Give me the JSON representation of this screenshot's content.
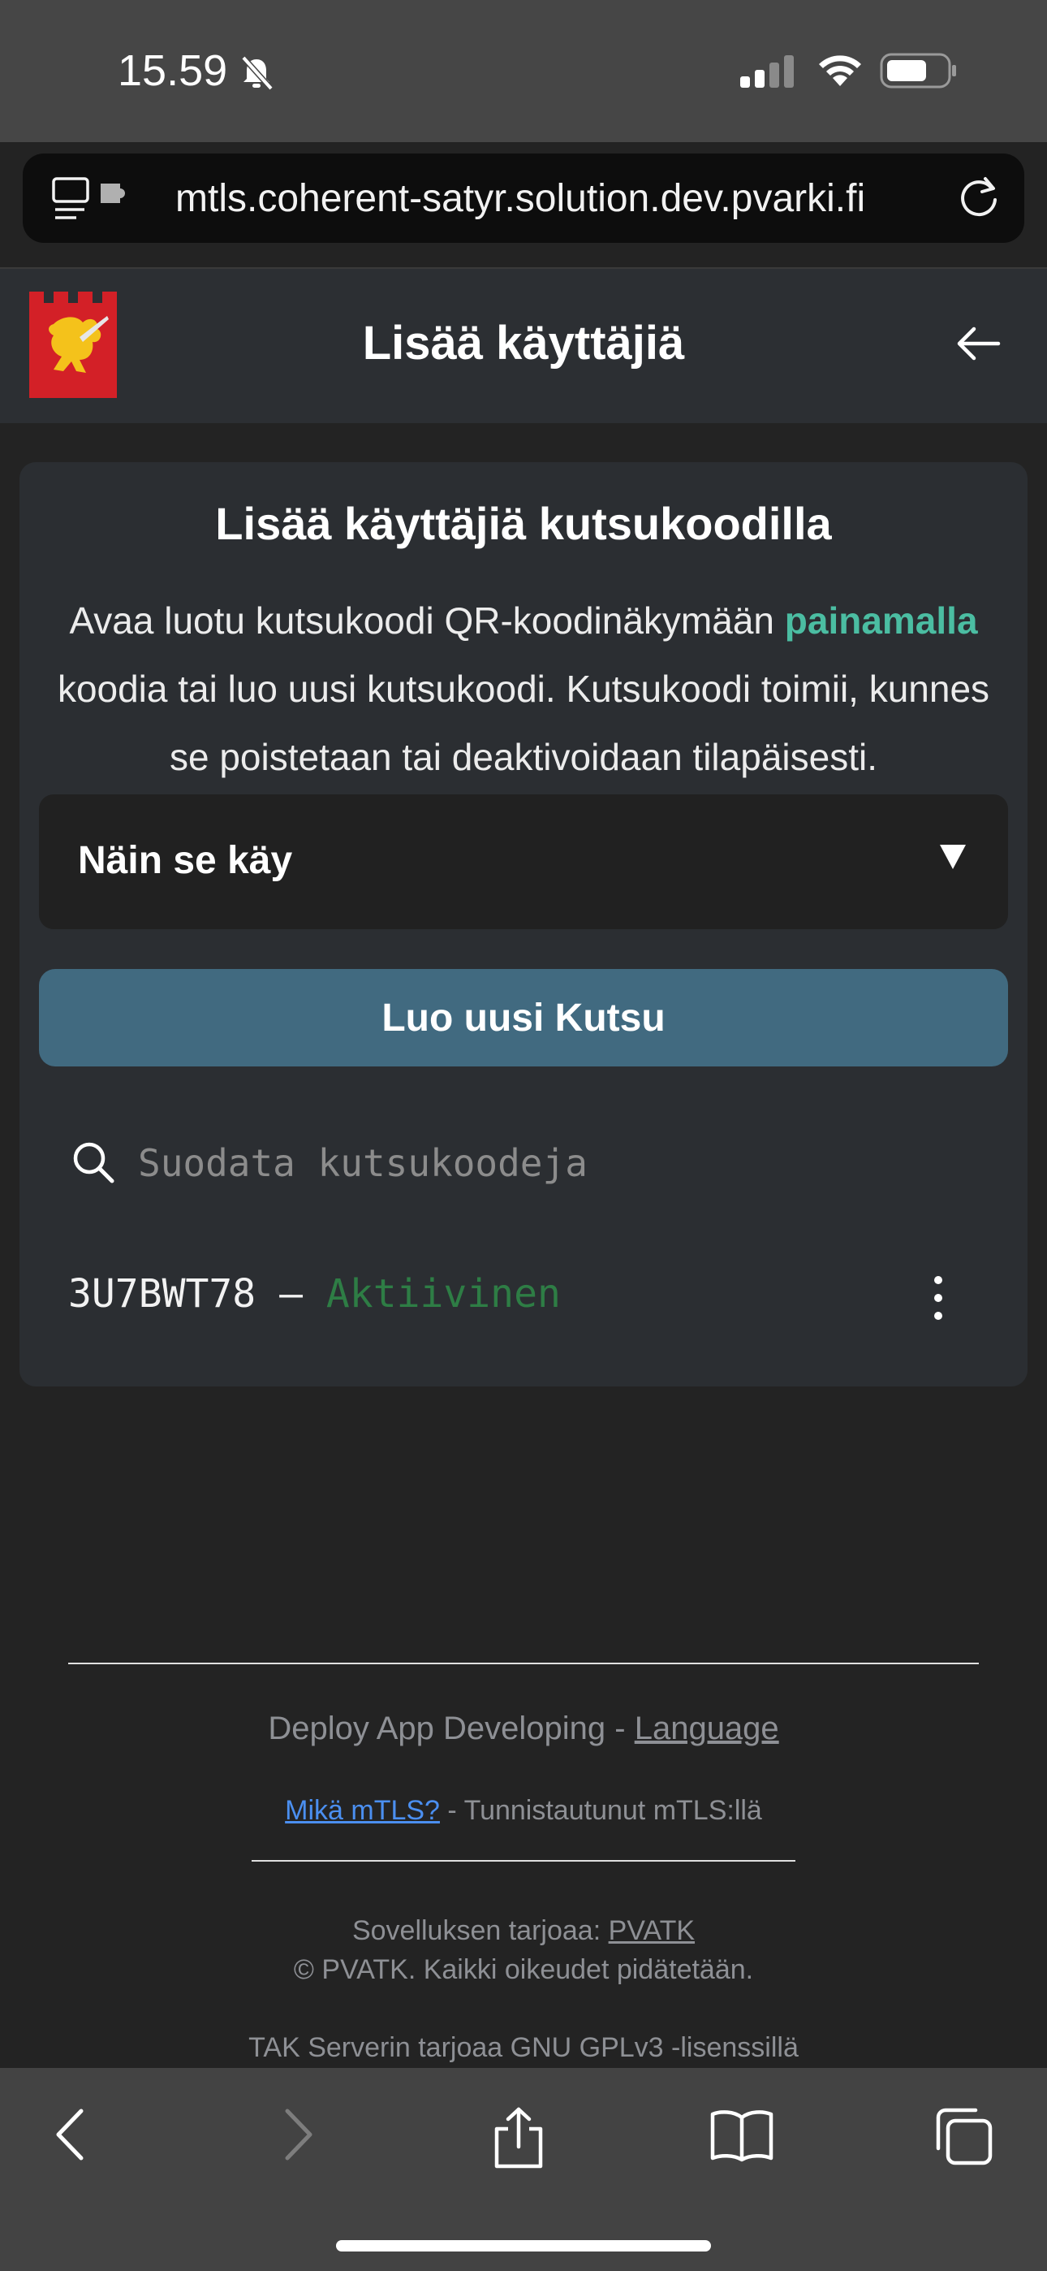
{
  "status_bar": {
    "time": "15.59"
  },
  "browser": {
    "url": "mtls.coherent-satyr.solution.dev.pvarki.fi"
  },
  "header": {
    "title": "Lisää käyttäjiä"
  },
  "card": {
    "title": "Lisää käyttäjiä kutsukoodilla",
    "desc_pre": "Avaa luotu kutsukoodi QR-koodinäkymään ",
    "desc_accent": "painamalla",
    "desc_post": " koodia tai luo uusi kutsukoodi. Kutsukoodi toimii, kunnes se poistetaan tai deaktivoidaan tilapäisesti.",
    "howto_label": "Näin se käy",
    "create_button": "Luo uusi Kutsu",
    "search_placeholder": "Suodata kutsukoodeja",
    "codes": [
      {
        "code": "3U7BWT78",
        "separator": " – ",
        "status": "Aktiivinen"
      }
    ]
  },
  "footer": {
    "deploy_text": "Deploy App Developing - ",
    "language_link": "Language",
    "mtls_link": "Mikä mTLS?",
    "mtls_text": " - Tunnistautunut mTLS:llä",
    "provider_text": "Sovelluksen tarjoaa: ",
    "provider_link": "PVATK",
    "copyright": "© PVATK. Kaikki oikeudet pidätetään.",
    "tak_text": "TAK Serverin tarjoaa GNU GPLv3 -lisenssillä"
  },
  "colors": {
    "accent": "#4bbda2",
    "active_status": "#2e7d45",
    "button": "#416a80",
    "link": "#4b8ff0"
  }
}
